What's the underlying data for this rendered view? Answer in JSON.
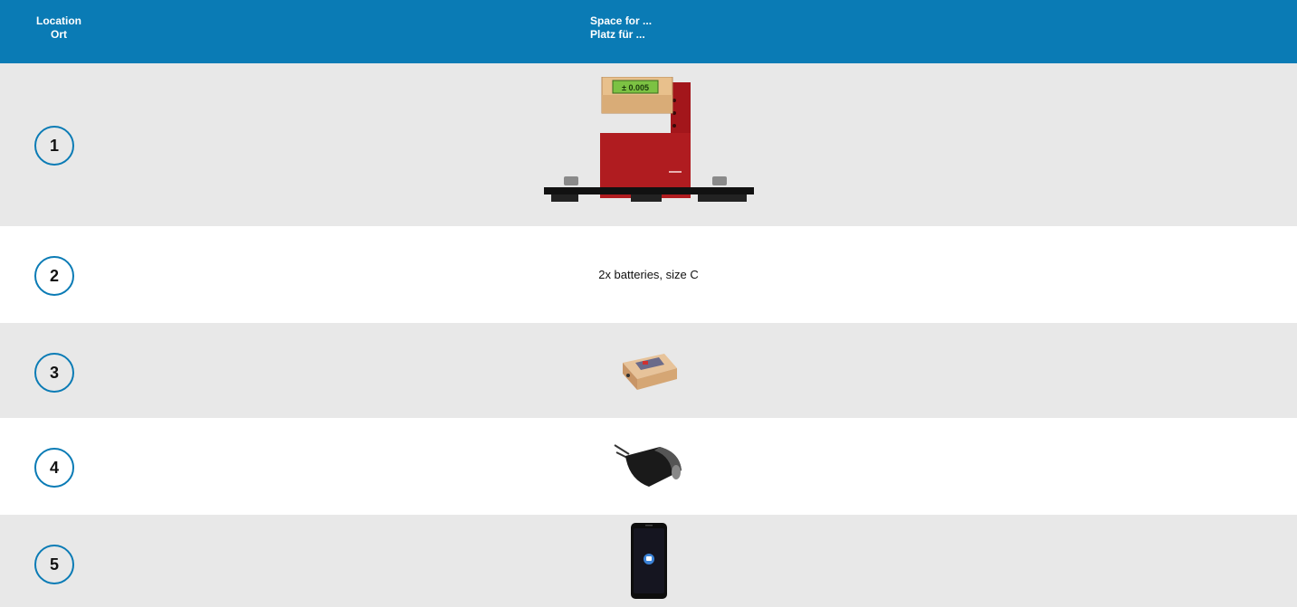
{
  "header": {
    "location_en": "Location",
    "location_de": "Ort",
    "space_en": "Space for ...",
    "space_de": "Platz für ..."
  },
  "rows": [
    {
      "number": "1",
      "content_icon": "level-gauge-device-image",
      "display_text": "± 0.005"
    },
    {
      "number": "2",
      "content_text": "2x batteries, size C"
    },
    {
      "number": "3",
      "content_icon": "sensor-module-image"
    },
    {
      "number": "4",
      "content_icon": "usb-charger-image"
    },
    {
      "number": "5",
      "content_icon": "smartphone-image"
    }
  ],
  "colors": {
    "header_bg": "#0a7bb5",
    "row_gray": "#e8e8e8",
    "circle_border": "#0a7bb5"
  }
}
